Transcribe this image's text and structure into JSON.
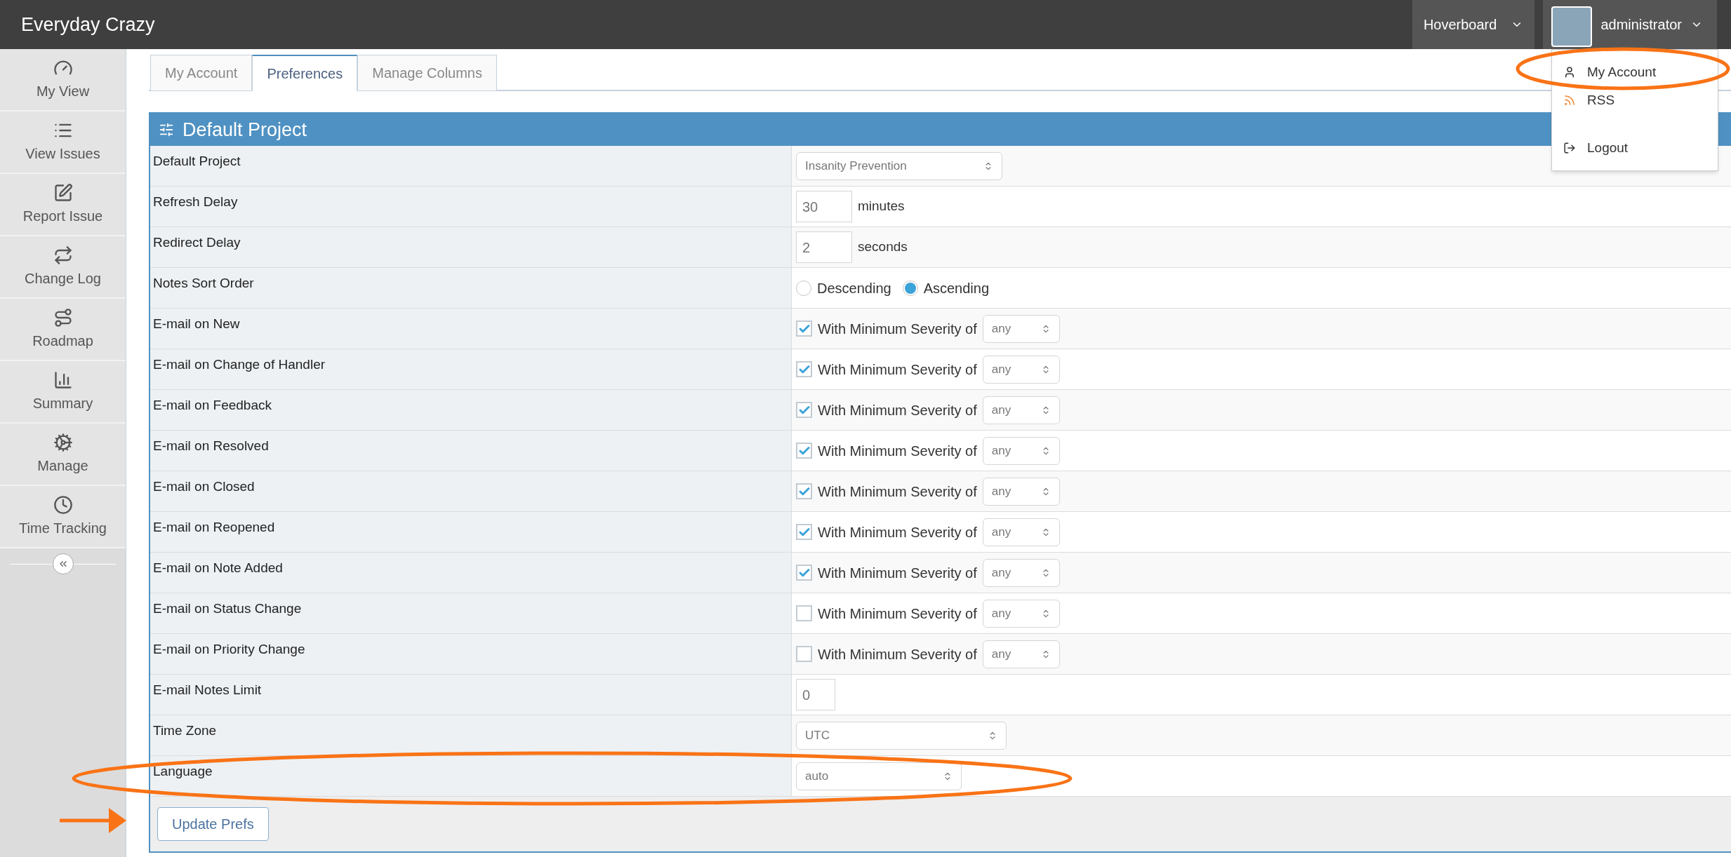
{
  "navbar": {
    "brand": "Everyday Crazy",
    "project_menu": "Hoverboard",
    "user_menu": "administrator"
  },
  "user_dropdown": [
    {
      "label": "My Account"
    },
    {
      "label": "RSS"
    },
    {
      "label": "Logout"
    }
  ],
  "sidebar": {
    "items": [
      {
        "label": "My View"
      },
      {
        "label": "View Issues"
      },
      {
        "label": "Report Issue"
      },
      {
        "label": "Change Log"
      },
      {
        "label": "Roadmap"
      },
      {
        "label": "Summary"
      },
      {
        "label": "Manage"
      },
      {
        "label": "Time Tracking"
      }
    ]
  },
  "tabs": [
    {
      "label": "My Account",
      "selected": false
    },
    {
      "label": "Preferences",
      "selected": true
    },
    {
      "label": "Manage Columns",
      "selected": false
    }
  ],
  "panel": {
    "title": "Default Project"
  },
  "rows": [
    {
      "label": "Default Project",
      "kind": "select",
      "value": "Insanity Prevention"
    },
    {
      "label": "Refresh Delay",
      "kind": "number",
      "value": "30",
      "unit": "minutes"
    },
    {
      "label": "Redirect Delay",
      "kind": "number",
      "value": "2",
      "unit": "seconds"
    },
    {
      "label": "Notes Sort Order",
      "kind": "radio",
      "options": [
        {
          "label": "Descending",
          "selected": false
        },
        {
          "label": "Ascending",
          "selected": true
        }
      ]
    },
    {
      "label": "E-mail on New",
      "kind": "email",
      "checked": true,
      "text": "With Minimum Severity of",
      "value": "any"
    },
    {
      "label": "E-mail on Change of Handler",
      "kind": "email",
      "checked": true,
      "text": "With Minimum Severity of",
      "value": "any"
    },
    {
      "label": "E-mail on Feedback",
      "kind": "email",
      "checked": true,
      "text": "With Minimum Severity of",
      "value": "any"
    },
    {
      "label": "E-mail on Resolved",
      "kind": "email",
      "checked": true,
      "text": "With Minimum Severity of",
      "value": "any"
    },
    {
      "label": "E-mail on Closed",
      "kind": "email",
      "checked": true,
      "text": "With Minimum Severity of",
      "value": "any"
    },
    {
      "label": "E-mail on Reopened",
      "kind": "email",
      "checked": true,
      "text": "With Minimum Severity of",
      "value": "any"
    },
    {
      "label": "E-mail on Note Added",
      "kind": "email",
      "checked": true,
      "text": "With Minimum Severity of",
      "value": "any"
    },
    {
      "label": "E-mail on Status Change",
      "kind": "email",
      "checked": false,
      "text": "With Minimum Severity of",
      "value": "any"
    },
    {
      "label": "E-mail on Priority Change",
      "kind": "email",
      "checked": false,
      "text": "With Minimum Severity of",
      "value": "any"
    },
    {
      "label": "E-mail Notes Limit",
      "kind": "number",
      "value": "0"
    },
    {
      "label": "Time Zone",
      "kind": "select",
      "value": "UTC"
    },
    {
      "label": "Language",
      "kind": "select",
      "value": "auto"
    }
  ],
  "submit_button": "Update Prefs"
}
